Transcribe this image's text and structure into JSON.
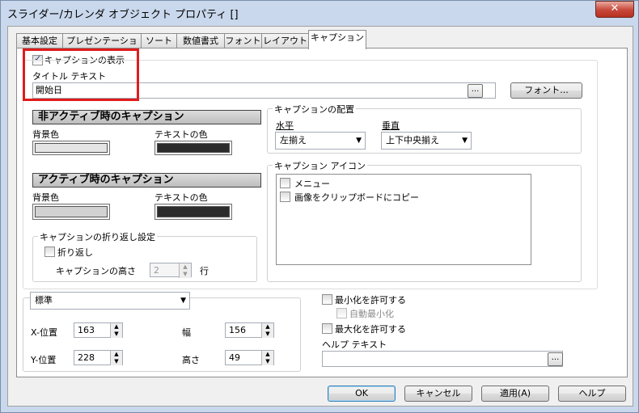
{
  "window": {
    "title": "スライダー/カレンダ オブジェクト プロパティ []",
    "close_glyph": "✕"
  },
  "tabs": [
    {
      "label": "基本設定"
    },
    {
      "label": "プレゼンテーション"
    },
    {
      "label": "ソート"
    },
    {
      "label": "数値書式"
    },
    {
      "label": "フォント"
    },
    {
      "label": "レイアウト"
    },
    {
      "label": "キャプション",
      "active": true
    }
  ],
  "caption": {
    "show_label": "キャプションの表示",
    "show_checked": true,
    "title_label": "タイトル テキスト",
    "title_value": "開始日",
    "dots_label": "...",
    "font_button": "フォント..."
  },
  "inactive": {
    "header": "非アクティブ時のキャプション",
    "bg_label": "背景色",
    "text_label": "テキストの色",
    "bg_color": "#e4e4e4",
    "text_color": "#2b2b2b"
  },
  "active": {
    "header": "アクティブ時のキャプション",
    "bg_label": "背景色",
    "text_label": "テキストの色",
    "bg_color": "#d2d2d2",
    "text_color": "#2b2b2b"
  },
  "wrap": {
    "group_label": "キャプションの折り返し設定",
    "wrap_label": "折り返し",
    "wrap_checked": false,
    "height_label": "キャプションの高さ",
    "height_value": "2",
    "unit": "行"
  },
  "alignment": {
    "group_label": "キャプションの配置",
    "horizontal_label": "水平",
    "vertical_label": "垂直",
    "horizontal_value": "左揃え",
    "vertical_value": "上下中央揃え"
  },
  "icons": {
    "group_label": "キャプション アイコン",
    "items": [
      {
        "label": "メニュー",
        "checked": false
      },
      {
        "label": "画像をクリップボードにコピー",
        "checked": false
      }
    ]
  },
  "size": {
    "mode_value": "標準",
    "x_label": "X-位置",
    "x_value": "163",
    "y_label": "Y-位置",
    "y_value": "228",
    "width_label": "幅",
    "width_value": "156",
    "height_label": "高さ",
    "height_value": "49"
  },
  "options": {
    "minimize_label": "最小化を許可する",
    "auto_minimize_label": "自動最小化",
    "maximize_label": "最大化を許可する",
    "help_label": "ヘルプ テキスト",
    "help_value": ""
  },
  "buttons": {
    "ok": "OK",
    "cancel": "キャンセル",
    "apply": "適用(A)",
    "help": "ヘルプ"
  },
  "colors": {
    "highlight": "#e01c1c"
  }
}
